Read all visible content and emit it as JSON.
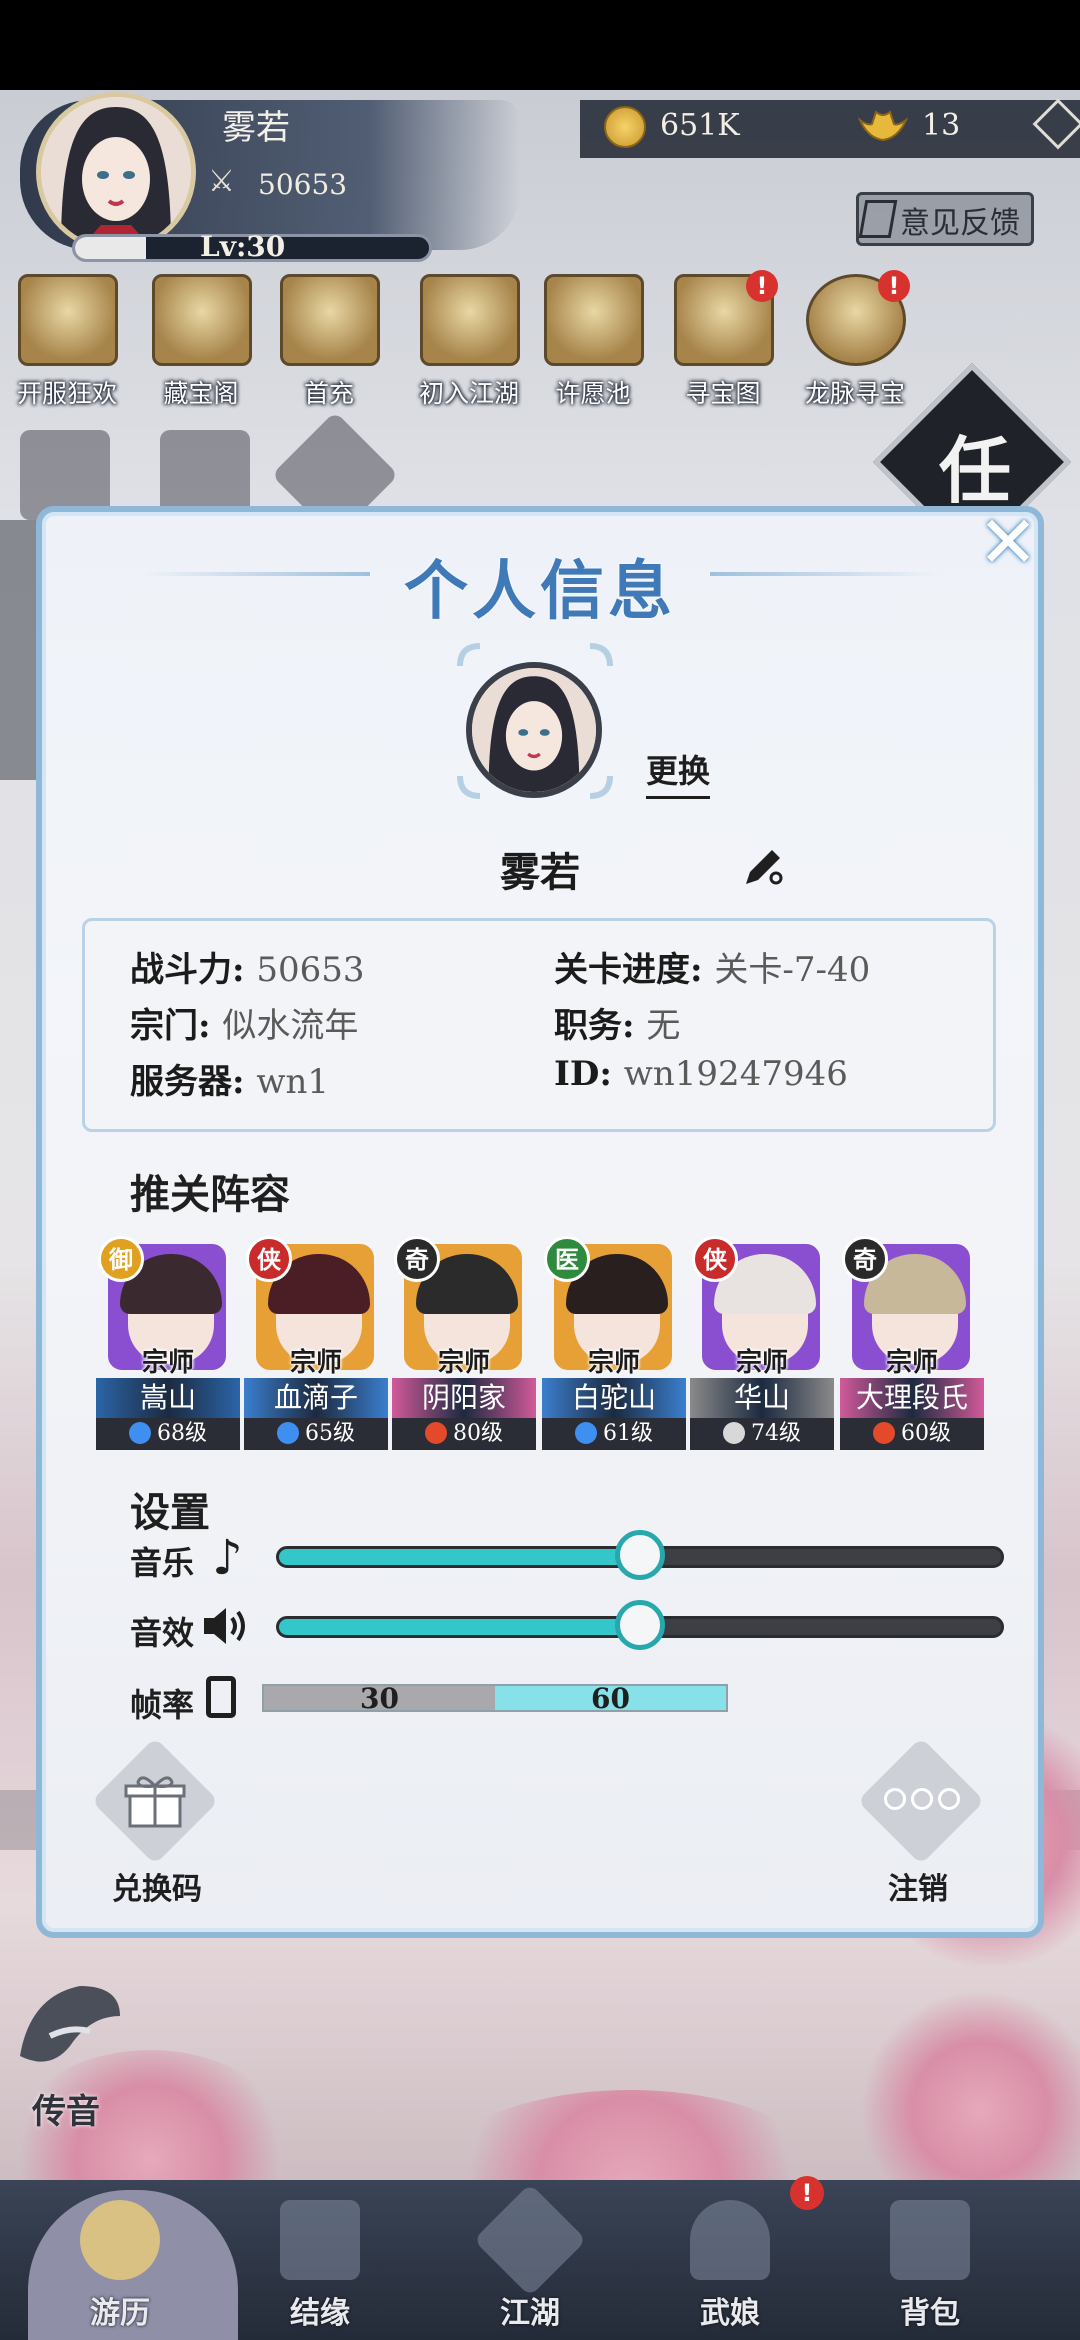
{
  "player": {
    "name": "雾若",
    "power": "50653",
    "level_text": "Lv:30",
    "level_progress": 0.2
  },
  "currency": {
    "coins": "651K",
    "ingots": "13"
  },
  "feedback_label": "意见反馈",
  "events": [
    {
      "label": "开服狂欢",
      "alert": false
    },
    {
      "label": "藏宝阁",
      "alert": false
    },
    {
      "label": "首充",
      "alert": false
    },
    {
      "label": "初入江湖",
      "alert": false
    },
    {
      "label": "许愿池",
      "alert": false
    },
    {
      "label": "寻宝图",
      "alert": true
    },
    {
      "label": "龙脉寻宝",
      "alert": true
    }
  ],
  "task_label": "任",
  "modal": {
    "title": "个人信息",
    "change_label": "更换",
    "name": "雾若",
    "info": {
      "power_label": "战斗力:",
      "power_value": "50653",
      "stage_label": "关卡进度:",
      "stage_value": "关卡-7-40",
      "sect_label": "宗门:",
      "sect_value": "似水流年",
      "role_label": "职务:",
      "role_value": "无",
      "server_label": "服务器:",
      "server_value": "wn1",
      "id_label": "ID:",
      "id_value": "wn19247946"
    },
    "lineup_title": "推关阵容",
    "heroes": [
      {
        "badge": "御",
        "rank": "宗师",
        "name": "嵩山",
        "level": "68级",
        "element": "water"
      },
      {
        "badge": "侠",
        "rank": "宗师",
        "name": "血滴子",
        "level": "65级",
        "element": "water"
      },
      {
        "badge": "奇",
        "rank": "宗师",
        "name": "阴阳家",
        "level": "80级",
        "element": "fire"
      },
      {
        "badge": "医",
        "rank": "宗师",
        "name": "白驼山",
        "level": "61级",
        "element": "water"
      },
      {
        "badge": "侠",
        "rank": "宗师",
        "name": "华山",
        "level": "74级",
        "element": "wind"
      },
      {
        "badge": "奇",
        "rank": "宗师",
        "name": "大理段氏",
        "level": "60级",
        "element": "fire"
      }
    ],
    "settings_title": "设置",
    "music_label": "音乐",
    "music_level": 0.5,
    "sfx_label": "音效",
    "sfx_level": 0.5,
    "fps_label": "帧率",
    "fps_options": [
      "30",
      "60"
    ],
    "fps_selected": "60",
    "redeem_label": "兑换码",
    "logout_label": "注销"
  },
  "chat_label": "传音",
  "nav": [
    {
      "label": "游历",
      "active": true
    },
    {
      "label": "结缘",
      "active": false
    },
    {
      "label": "江湖",
      "active": false
    },
    {
      "label": "武娘",
      "active": false,
      "alert": true
    },
    {
      "label": "背包",
      "active": false
    }
  ],
  "colors": {
    "accent": "#3f79b7",
    "slider": "#33c7c9",
    "alert": "#d8322f"
  }
}
